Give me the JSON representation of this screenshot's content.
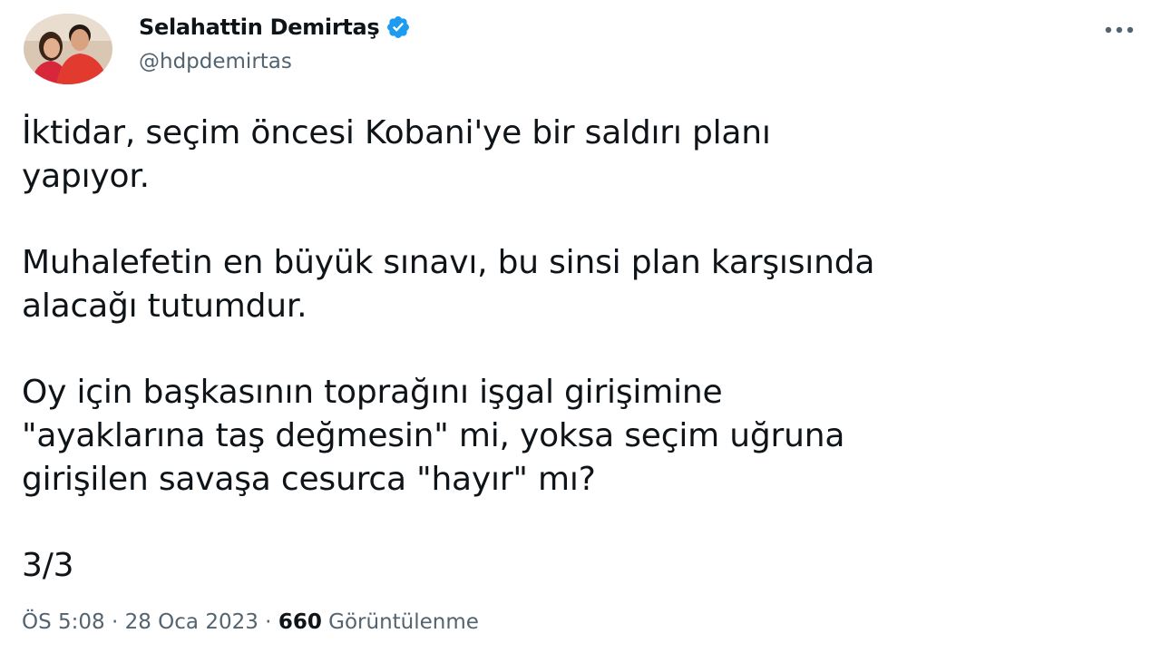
{
  "author": {
    "display_name": "Selahattin Demirtaş",
    "handle": "@hdpdemirtas",
    "verified": true,
    "avatar_icon": "user-avatar-photo"
  },
  "tweet": {
    "paragraphs": [
      "İktidar, seçim öncesi Kobani'ye bir saldırı planı\nyapıyor.",
      "Muhalefetin en büyük sınavı, bu sinsi plan karşısında\nalacağı tutumdur.",
      "Oy için başkasının toprağını işgal girişimine\n\"ayaklarına taş değmesin\" mi, yoksa seçim uğruna\ngirişilen savaşa cesurca \"hayır\" mı?",
      "3/3"
    ]
  },
  "meta": {
    "time": "ÖS 5:08",
    "separator": " · ",
    "date": "28 Oca 2023",
    "views_count": "660",
    "views_label": "Görüntülenme"
  },
  "colors": {
    "text": "#0f1419",
    "secondary": "#536471",
    "verified_badge": "#1d9bf0"
  },
  "icons": {
    "more": "more-horizontal-icon",
    "verified": "verified-badge-icon"
  }
}
